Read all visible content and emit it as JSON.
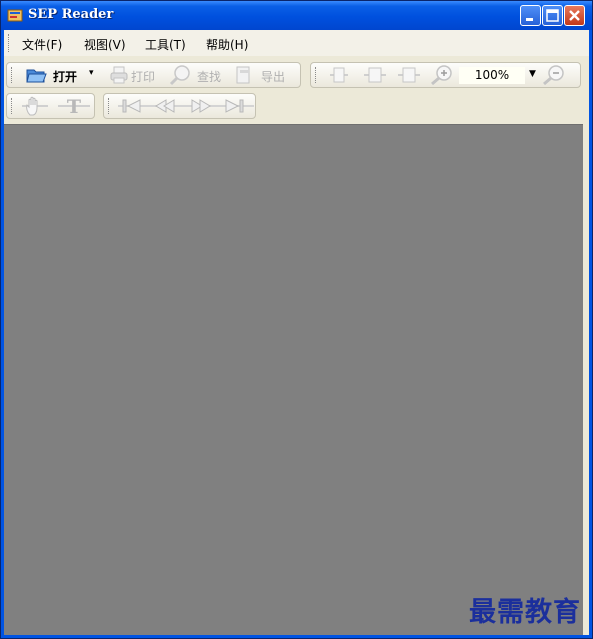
{
  "window": {
    "title": "SEP Reader"
  },
  "menu": {
    "file": "文件(F)",
    "view": "视图(V)",
    "tools": "工具(T)",
    "help": "帮助(H)"
  },
  "toolbar": {
    "open": "打开",
    "print": "打印",
    "find": "查找",
    "export": "导出"
  },
  "zoom": {
    "value": "100%"
  },
  "watermark": "最需教育",
  "colors": {
    "titlebar": "#0050de",
    "viewport": "#808080",
    "toolbar_bg": "#ebe8dc",
    "watermark": "#1b2f9c"
  }
}
